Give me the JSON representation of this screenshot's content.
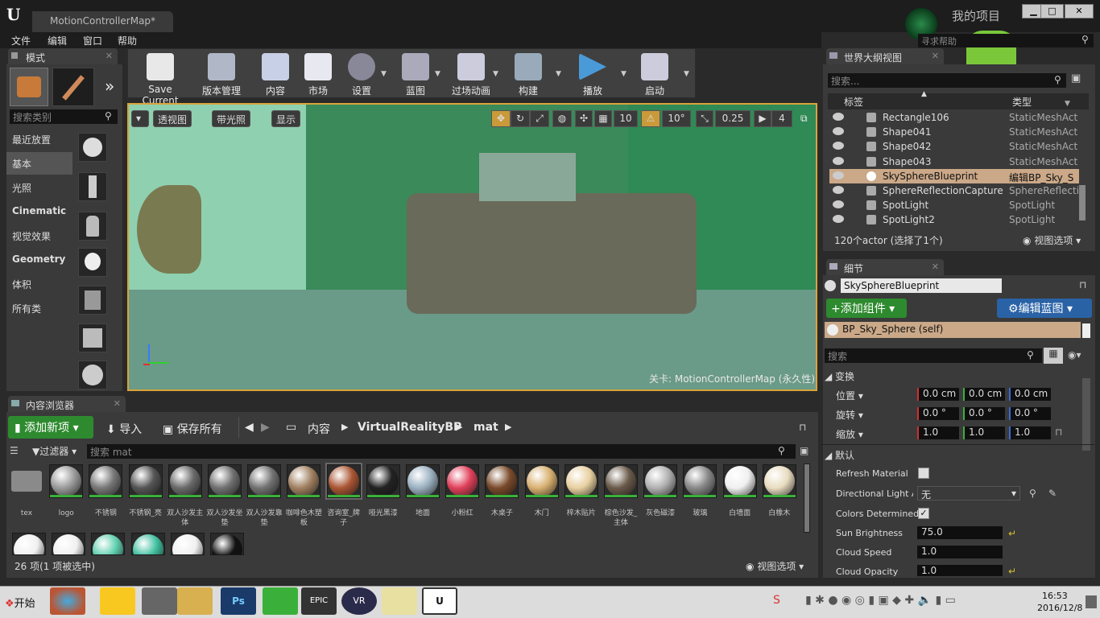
{
  "window": {
    "tab_title": "MotionControllerMap*",
    "project": "我的项目",
    "search_help_placeholder": "寻求帮助",
    "min": "▁",
    "max": "□",
    "close": "✕"
  },
  "menu": [
    "文件",
    "编辑",
    "窗口",
    "帮助"
  ],
  "modes": {
    "tab": "模式",
    "search_placeholder": "搜索类别",
    "categories": [
      "最近放置",
      "基本",
      "光照",
      "Cinematic",
      "视觉效果",
      "Geometry",
      "体积",
      "所有类"
    ],
    "selected": "基本"
  },
  "toolbar": {
    "buttons": [
      "Save Current",
      "版本管理",
      "内容",
      "市场",
      "设置",
      "蓝图",
      "过场动画",
      "构建",
      "播放",
      "启动"
    ]
  },
  "viewport": {
    "perspective": "透视图",
    "lit": "带光照",
    "show": "显示",
    "grid_snap": "10",
    "rot_snap": "10°",
    "scale_snap": "0.25",
    "camera_speed": "4",
    "level_label": "关卡: MotionControllerMap (永久性)"
  },
  "content_browser": {
    "tab": "内容浏览器",
    "add_new": "添加新项",
    "import": "导入",
    "save_all": "保存所有",
    "path": [
      "内容",
      "VirtualRealityBP",
      "mat"
    ],
    "filters": "过滤器",
    "search_placeholder": "搜索 mat",
    "status": "26 项(1 项被选中)",
    "view_options": "视图选项",
    "assets": [
      {
        "label": "tex",
        "color": "#8a8a8a"
      },
      {
        "label": "logo",
        "color": "#9a9a9a"
      },
      {
        "label": "不锈钢",
        "color": "#777"
      },
      {
        "label": "不锈钢_亮",
        "color": "#555"
      },
      {
        "label": "双人沙发主体",
        "color": "#6a6a6a"
      },
      {
        "label": "双人沙发坐垫",
        "color": "#707070"
      },
      {
        "label": "双人沙发靠垫",
        "color": "#727272"
      },
      {
        "label": "咖啡色木塑板",
        "color": "#a08060"
      },
      {
        "label": "咨询室_牌子",
        "color": "#aa5533"
      },
      {
        "label": "哑光黑漆",
        "color": "#222"
      },
      {
        "label": "地面",
        "color": "#9ab0c0"
      },
      {
        "label": "小粉红",
        "color": "#e0405a"
      },
      {
        "label": "木桌子",
        "color": "#7a4a2a"
      },
      {
        "label": "木门",
        "color": "#d8b070"
      },
      {
        "label": "梓木贴片",
        "color": "#e8d0a0"
      },
      {
        "label": "棕色沙发_主体",
        "color": "#6a5a4a"
      },
      {
        "label": "灰色磁漆",
        "color": "#b0b0b0"
      },
      {
        "label": "玻璃",
        "color": "#888"
      },
      {
        "label": "白墙面",
        "color": "#f0f0f0"
      },
      {
        "label": "白橡木",
        "color": "#e8dcc0"
      }
    ],
    "row2_colors": [
      "#f0f0f0",
      "#f0f0f0",
      "#60d0b0",
      "#40c0a0",
      "#f0f0f0",
      "#111"
    ]
  },
  "outliner": {
    "tab": "世界大纲视图",
    "search_placeholder": "搜索...",
    "col_label": "标签",
    "col_type": "类型",
    "rows": [
      {
        "name": "Rectangle106",
        "type": "StaticMeshActo"
      },
      {
        "name": "Shape041",
        "type": "StaticMeshActo"
      },
      {
        "name": "Shape042",
        "type": "StaticMeshActo"
      },
      {
        "name": "Shape043",
        "type": "StaticMeshActo"
      },
      {
        "name": "SkySphereBlueprint",
        "type": "编辑BP_Sky_S",
        "selected": true
      },
      {
        "name": "SphereReflectionCapture",
        "type": "SphereReflectio"
      },
      {
        "name": "SpotLight",
        "type": "SpotLight"
      },
      {
        "name": "SpotLight2",
        "type": "SpotLight"
      }
    ],
    "status": "120个actor (选择了1个)",
    "view_options": "视图选项"
  },
  "details": {
    "tab": "细节",
    "actor_name": "SkySphereBlueprint",
    "add_component": "添加组件",
    "edit_blueprint": "编辑蓝图",
    "component_self": "BP_Sky_Sphere (self)",
    "search_placeholder": "搜索",
    "transform_header": "变换",
    "position": "位置",
    "rotation": "旋转",
    "scale": "缩放",
    "position_values": [
      "0.0 cm",
      "0.0 cm",
      "0.0 cm"
    ],
    "rotation_values": [
      "0.0 °",
      "0.0 °",
      "0.0 °"
    ],
    "scale_values": [
      "1.0",
      "1.0",
      "1.0"
    ],
    "default_header": "默认",
    "refresh_material": "Refresh Material",
    "directional_light": "Directional Light Ac",
    "directional_light_value": "无",
    "colors_determined": "Colors Determined",
    "sun_brightness": "Sun Brightness",
    "sun_brightness_value": "75.0",
    "cloud_speed": "Cloud Speed",
    "cloud_speed_value": "1.0",
    "cloud_opacity": "Cloud Opacity",
    "cloud_opacity_value": "1.0"
  },
  "taskbar": {
    "start": "开始",
    "time": "16:53",
    "date": "2016/12/8"
  }
}
